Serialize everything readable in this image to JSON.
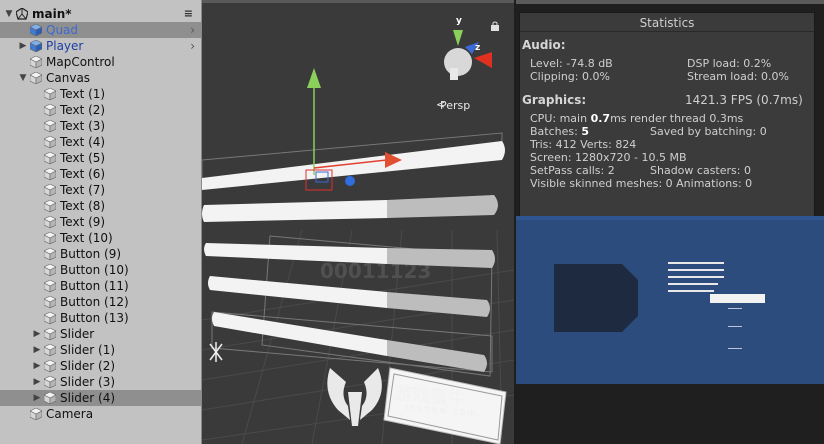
{
  "hierarchy": {
    "items": [
      {
        "label": "main*",
        "indent": 0,
        "expand": "down",
        "icon": "unity",
        "header": true
      },
      {
        "label": "Quad",
        "indent": 1,
        "expand": "",
        "icon": "cube-blue",
        "selected": true,
        "chevron": true,
        "color": "selblue"
      },
      {
        "label": "Player",
        "indent": 1,
        "expand": "right",
        "icon": "cube-blue",
        "chevron": true,
        "color": "blue"
      },
      {
        "label": "MapControl",
        "indent": 1,
        "expand": "",
        "icon": "cube"
      },
      {
        "label": "Canvas",
        "indent": 1,
        "expand": "down",
        "icon": "cube"
      },
      {
        "label": "Text (1)",
        "indent": 2,
        "expand": "",
        "icon": "cube"
      },
      {
        "label": "Text (2)",
        "indent": 2,
        "expand": "",
        "icon": "cube"
      },
      {
        "label": "Text (3)",
        "indent": 2,
        "expand": "",
        "icon": "cube"
      },
      {
        "label": "Text (4)",
        "indent": 2,
        "expand": "",
        "icon": "cube"
      },
      {
        "label": "Text (5)",
        "indent": 2,
        "expand": "",
        "icon": "cube"
      },
      {
        "label": "Text (6)",
        "indent": 2,
        "expand": "",
        "icon": "cube"
      },
      {
        "label": "Text (7)",
        "indent": 2,
        "expand": "",
        "icon": "cube"
      },
      {
        "label": "Text (8)",
        "indent": 2,
        "expand": "",
        "icon": "cube"
      },
      {
        "label": "Text (9)",
        "indent": 2,
        "expand": "",
        "icon": "cube"
      },
      {
        "label": "Text (10)",
        "indent": 2,
        "expand": "",
        "icon": "cube"
      },
      {
        "label": "Button (9)",
        "indent": 2,
        "expand": "",
        "icon": "cube"
      },
      {
        "label": "Button (10)",
        "indent": 2,
        "expand": "",
        "icon": "cube"
      },
      {
        "label": "Button (11)",
        "indent": 2,
        "expand": "",
        "icon": "cube"
      },
      {
        "label": "Button (12)",
        "indent": 2,
        "expand": "",
        "icon": "cube"
      },
      {
        "label": "Button (13)",
        "indent": 2,
        "expand": "",
        "icon": "cube"
      },
      {
        "label": "Slider",
        "indent": 2,
        "expand": "right",
        "icon": "cube"
      },
      {
        "label": "Slider (1)",
        "indent": 2,
        "expand": "right",
        "icon": "cube"
      },
      {
        "label": "Slider (2)",
        "indent": 2,
        "expand": "right",
        "icon": "cube"
      },
      {
        "label": "Slider (3)",
        "indent": 2,
        "expand": "right",
        "icon": "cube"
      },
      {
        "label": "Slider (4)",
        "indent": 2,
        "expand": "right",
        "icon": "cube",
        "selected": true
      },
      {
        "label": "Camera",
        "indent": 1,
        "expand": "",
        "icon": "cube"
      }
    ]
  },
  "scene": {
    "projection_label": "Persp",
    "gizmo_axes": {
      "y": "y",
      "z": "z"
    },
    "watermark_site": "游戏蛮牛",
    "watermark_url": "manew.com"
  },
  "stats": {
    "title": "Statistics",
    "audio_head": "Audio:",
    "level": "Level: -74.8 dB",
    "dsp": "DSP load: 0.2%",
    "clipping": "Clipping: 0.0%",
    "stream": "Stream load: 0.0%",
    "graphics_head": "Graphics:",
    "fps": "1421.3 FPS (0.7ms)",
    "cpu_pre": "CPU: main ",
    "cpu_main": "0.7",
    "cpu_post": "ms  render thread 0.3ms",
    "batches_pre": "Batches: ",
    "batches": "5",
    "saved": "Saved by batching: 0",
    "tris": "Tris: 412  Verts: 824",
    "screen": "Screen: 1280x720 - 10.5 MB",
    "setpass": "SetPass calls: 2",
    "shadow": "Shadow casters: 0",
    "skinned": "Visible skinned meshes: 0  Animations: 0"
  },
  "colors": {
    "hierarchy_bg": "#c2c2c2",
    "selection": "#8f8f8f",
    "game_bg": "#2d4c7e",
    "stats_bg": "#3c3c3c"
  }
}
